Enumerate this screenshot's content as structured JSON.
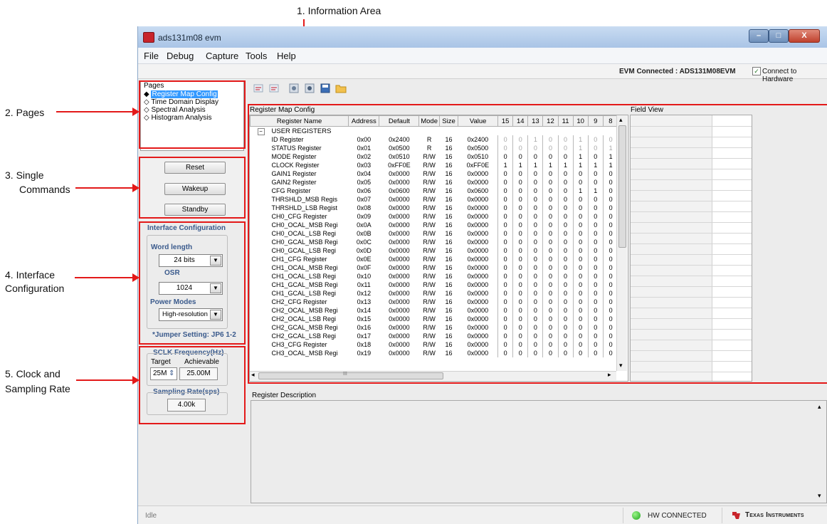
{
  "annotations": {
    "info_area": "1. Information Area",
    "pages": "2. Pages",
    "single_cmds_1": "3. Single",
    "single_cmds_2": "Commands",
    "iface_1": "4. Interface",
    "iface_2": "Configuration",
    "clock_1": "5. Clock and",
    "clock_2": "Sampling Rate"
  },
  "window": {
    "title": "ads131m08 evm",
    "minimize": "–",
    "maximize": "□",
    "close": "X"
  },
  "menu": [
    "File",
    "Debug",
    "Capture",
    "Tools",
    "Help"
  ],
  "status": {
    "evm": "EVM Connected : ADS131M08EVM",
    "hw_check": "✓",
    "hw_label": "Connect to Hardware"
  },
  "pages": {
    "title": "Pages",
    "items": [
      "Register Map Config",
      "Time Domain Display",
      "Spectral Analysis",
      "Histogram Analysis"
    ],
    "selected_bullet": "◆",
    "bullet": "◇"
  },
  "commands": {
    "reset": "Reset",
    "wakeup": "Wakeup",
    "standby": "Standby"
  },
  "interface": {
    "title": "Interface Configuration",
    "word_length_label": "Word length",
    "word_length_value": "24 bits",
    "osr_label": "OSR",
    "osr_value": "1024",
    "power_label": "Power Modes",
    "power_value": "High-resolution",
    "jumper": "*Jumper Setting: JP6 1-2",
    "dropdown_arrow": "▼"
  },
  "clock": {
    "sclk_title": "SCLK Frequency(Hz)",
    "target_label": "Target",
    "achievable_label": "Achievable",
    "target_value": "25M",
    "spin": "⇕",
    "achievable_value": "25.00M",
    "sampling_title": "Sampling Rate(sps)",
    "sampling_value": "4.00k"
  },
  "toolbar_icons": [
    "read-register-icon",
    "write-register-icon",
    "read-all-icon",
    "write-all-icon",
    "save-icon",
    "open-folder-icon"
  ],
  "register_map": {
    "title": "Register Map Config",
    "headers": [
      "Register Name",
      "Address",
      "Default",
      "Mode",
      "Size",
      "Value",
      "15",
      "14",
      "13",
      "12",
      "11",
      "10",
      "9",
      "8"
    ],
    "group": "USER REGISTERS",
    "group_toggle": "−",
    "rows": [
      [
        "ID Register",
        "0x00",
        "0x2400",
        "R",
        "16",
        "0x2400"
      ],
      [
        "STATUS Register",
        "0x01",
        "0x0500",
        "R",
        "16",
        "0x0500"
      ],
      [
        "MODE Register",
        "0x02",
        "0x0510",
        "R/W",
        "16",
        "0x0510"
      ],
      [
        "CLOCK Register",
        "0x03",
        "0xFF0E",
        "R/W",
        "16",
        "0xFF0E"
      ],
      [
        "GAIN1 Register",
        "0x04",
        "0x0000",
        "R/W",
        "16",
        "0x0000"
      ],
      [
        "GAIN2 Register",
        "0x05",
        "0x0000",
        "R/W",
        "16",
        "0x0000"
      ],
      [
        "CFG Register",
        "0x06",
        "0x0600",
        "R/W",
        "16",
        "0x0600"
      ],
      [
        "THRSHLD_MSB Regis",
        "0x07",
        "0x0000",
        "R/W",
        "16",
        "0x0000"
      ],
      [
        "THRSHLD_LSB Regist",
        "0x08",
        "0x0000",
        "R/W",
        "16",
        "0x0000"
      ],
      [
        "CH0_CFG Register",
        "0x09",
        "0x0000",
        "R/W",
        "16",
        "0x0000"
      ],
      [
        "CH0_OCAL_MSB Regi",
        "0x0A",
        "0x0000",
        "R/W",
        "16",
        "0x0000"
      ],
      [
        "CH0_OCAL_LSB Regi",
        "0x0B",
        "0x0000",
        "R/W",
        "16",
        "0x0000"
      ],
      [
        "CH0_GCAL_MSB Regi",
        "0x0C",
        "0x0000",
        "R/W",
        "16",
        "0x0000"
      ],
      [
        "CH0_GCAL_LSB Regi",
        "0x0D",
        "0x0000",
        "R/W",
        "16",
        "0x0000"
      ],
      [
        "CH1_CFG Register",
        "0x0E",
        "0x0000",
        "R/W",
        "16",
        "0x0000"
      ],
      [
        "CH1_OCAL_MSB Regi",
        "0x0F",
        "0x0000",
        "R/W",
        "16",
        "0x0000"
      ],
      [
        "CH1_OCAL_LSB Regi",
        "0x10",
        "0x0000",
        "R/W",
        "16",
        "0x0000"
      ],
      [
        "CH1_GCAL_MSB Regi",
        "0x11",
        "0x0000",
        "R/W",
        "16",
        "0x0000"
      ],
      [
        "CH1_GCAL_LSB Regi",
        "0x12",
        "0x0000",
        "R/W",
        "16",
        "0x0000"
      ],
      [
        "CH2_CFG Register",
        "0x13",
        "0x0000",
        "R/W",
        "16",
        "0x0000"
      ],
      [
        "CH2_OCAL_MSB Regi",
        "0x14",
        "0x0000",
        "R/W",
        "16",
        "0x0000"
      ],
      [
        "CH2_OCAL_LSB Regi",
        "0x15",
        "0x0000",
        "R/W",
        "16",
        "0x0000"
      ],
      [
        "CH2_GCAL_MSB Regi",
        "0x16",
        "0x0000",
        "R/W",
        "16",
        "0x0000"
      ],
      [
        "CH2_GCAL_LSB Regi",
        "0x17",
        "0x0000",
        "R/W",
        "16",
        "0x0000"
      ],
      [
        "CH3_CFG Register",
        "0x18",
        "0x0000",
        "R/W",
        "16",
        "0x0000"
      ],
      [
        "CH3_OCAL_MSB Regi",
        "0x19",
        "0x0000",
        "R/W",
        "16",
        "0x0000"
      ]
    ],
    "bits": [
      [
        "0",
        "0",
        "1",
        "0",
        "0",
        "1",
        "0",
        "0"
      ],
      [
        "0",
        "0",
        "0",
        "0",
        "0",
        "1",
        "0",
        "1"
      ],
      [
        "0",
        "0",
        "0",
        "0",
        "0",
        "1",
        "0",
        "1"
      ],
      [
        "1",
        "1",
        "1",
        "1",
        "1",
        "1",
        "1",
        "1"
      ],
      [
        "0",
        "0",
        "0",
        "0",
        "0",
        "0",
        "0",
        "0"
      ],
      [
        "0",
        "0",
        "0",
        "0",
        "0",
        "0",
        "0",
        "0"
      ],
      [
        "0",
        "0",
        "0",
        "0",
        "0",
        "1",
        "1",
        "0"
      ],
      [
        "0",
        "0",
        "0",
        "0",
        "0",
        "0",
        "0",
        "0"
      ],
      [
        "0",
        "0",
        "0",
        "0",
        "0",
        "0",
        "0",
        "0"
      ],
      [
        "0",
        "0",
        "0",
        "0",
        "0",
        "0",
        "0",
        "0"
      ],
      [
        "0",
        "0",
        "0",
        "0",
        "0",
        "0",
        "0",
        "0"
      ],
      [
        "0",
        "0",
        "0",
        "0",
        "0",
        "0",
        "0",
        "0"
      ],
      [
        "0",
        "0",
        "0",
        "0",
        "0",
        "0",
        "0",
        "0"
      ],
      [
        "0",
        "0",
        "0",
        "0",
        "0",
        "0",
        "0",
        "0"
      ],
      [
        "0",
        "0",
        "0",
        "0",
        "0",
        "0",
        "0",
        "0"
      ],
      [
        "0",
        "0",
        "0",
        "0",
        "0",
        "0",
        "0",
        "0"
      ],
      [
        "0",
        "0",
        "0",
        "0",
        "0",
        "0",
        "0",
        "0"
      ],
      [
        "0",
        "0",
        "0",
        "0",
        "0",
        "0",
        "0",
        "0"
      ],
      [
        "0",
        "0",
        "0",
        "0",
        "0",
        "0",
        "0",
        "0"
      ],
      [
        "0",
        "0",
        "0",
        "0",
        "0",
        "0",
        "0",
        "0"
      ],
      [
        "0",
        "0",
        "0",
        "0",
        "0",
        "0",
        "0",
        "0"
      ],
      [
        "0",
        "0",
        "0",
        "0",
        "0",
        "0",
        "0",
        "0"
      ],
      [
        "0",
        "0",
        "0",
        "0",
        "0",
        "0",
        "0",
        "0"
      ],
      [
        "0",
        "0",
        "0",
        "0",
        "0",
        "0",
        "0",
        "0"
      ],
      [
        "0",
        "0",
        "0",
        "0",
        "0",
        "0",
        "0",
        "0"
      ],
      [
        "0",
        "0",
        "0",
        "0",
        "0",
        "0",
        "0",
        "0"
      ]
    ],
    "scroll_left": "◂",
    "scroll_right": "▸",
    "scroll_up": "▴",
    "scroll_down": "▾",
    "hscroll_mark": "III"
  },
  "field_view": {
    "title": "Field View"
  },
  "description": {
    "title": "Register Description",
    "scroll_up": "▴",
    "scroll_down": "▾"
  },
  "footer": {
    "status": "Idle",
    "hw": "HW CONNECTED",
    "brand": "Texas Instruments"
  }
}
